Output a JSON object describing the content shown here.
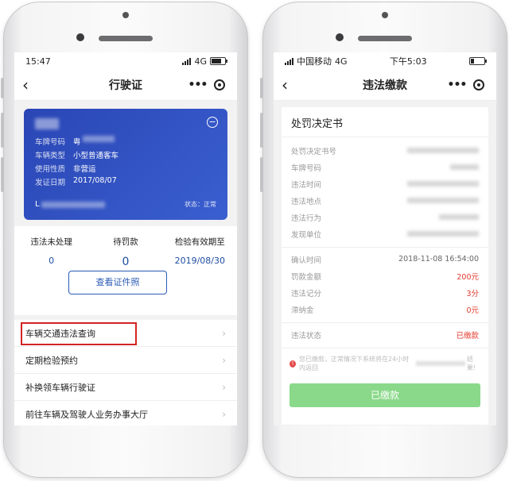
{
  "left": {
    "status": {
      "time": "15:47",
      "network": "4G"
    },
    "nav": {
      "title": "行驶证",
      "back": "‹"
    },
    "card": {
      "plate_label": "车牌号码",
      "plate_value": "粤",
      "type_label": "车辆类型",
      "type_value": "小型普通客车",
      "use_label": "使用性质",
      "use_value": "非营运",
      "issue_label": "发证日期",
      "issue_value": "2017/08/07",
      "vin_prefix": "L",
      "state": "状态：正常"
    },
    "stats": [
      {
        "label": "违法未处理",
        "value": "0"
      },
      {
        "label": "待罚款",
        "value": "0"
      },
      {
        "label": "检验有效期至",
        "value": "2019/08/30"
      }
    ],
    "cert_button": "查看证件照",
    "menu": [
      "车辆交通违法查询",
      "定期检验预约",
      "补换领车辆行驶证",
      "前往车辆及驾驶人业务办事大厅"
    ],
    "highlight_color": "#d32424"
  },
  "right": {
    "status": {
      "carrier": "中国移动",
      "network": "4G",
      "time": "下午5:03"
    },
    "nav": {
      "title": "违法缴款",
      "back": "‹"
    },
    "section_title": "处罚决定书",
    "fields_top": [
      "处罚决定书号",
      "车牌号码",
      "违法时间",
      "违法地点",
      "违法行为",
      "发现单位"
    ],
    "fields_mid": [
      {
        "label": "确认时间",
        "value": "2018-11-08 16:54:00"
      },
      {
        "label": "罚款金额",
        "value": "200元"
      },
      {
        "label": "违法记分",
        "value": "3分"
      },
      {
        "label": "滞纳金",
        "value": "0元"
      }
    ],
    "status_row": {
      "label": "违法状态",
      "value": "已缴款"
    },
    "warn": {
      "pre": "您已缴款，正常情况下系统将在24小时内返回",
      "post": "结果!"
    },
    "paid_button": "已缴款",
    "accent_red": "#e23b2e",
    "paid_green": "#8ad98a"
  }
}
